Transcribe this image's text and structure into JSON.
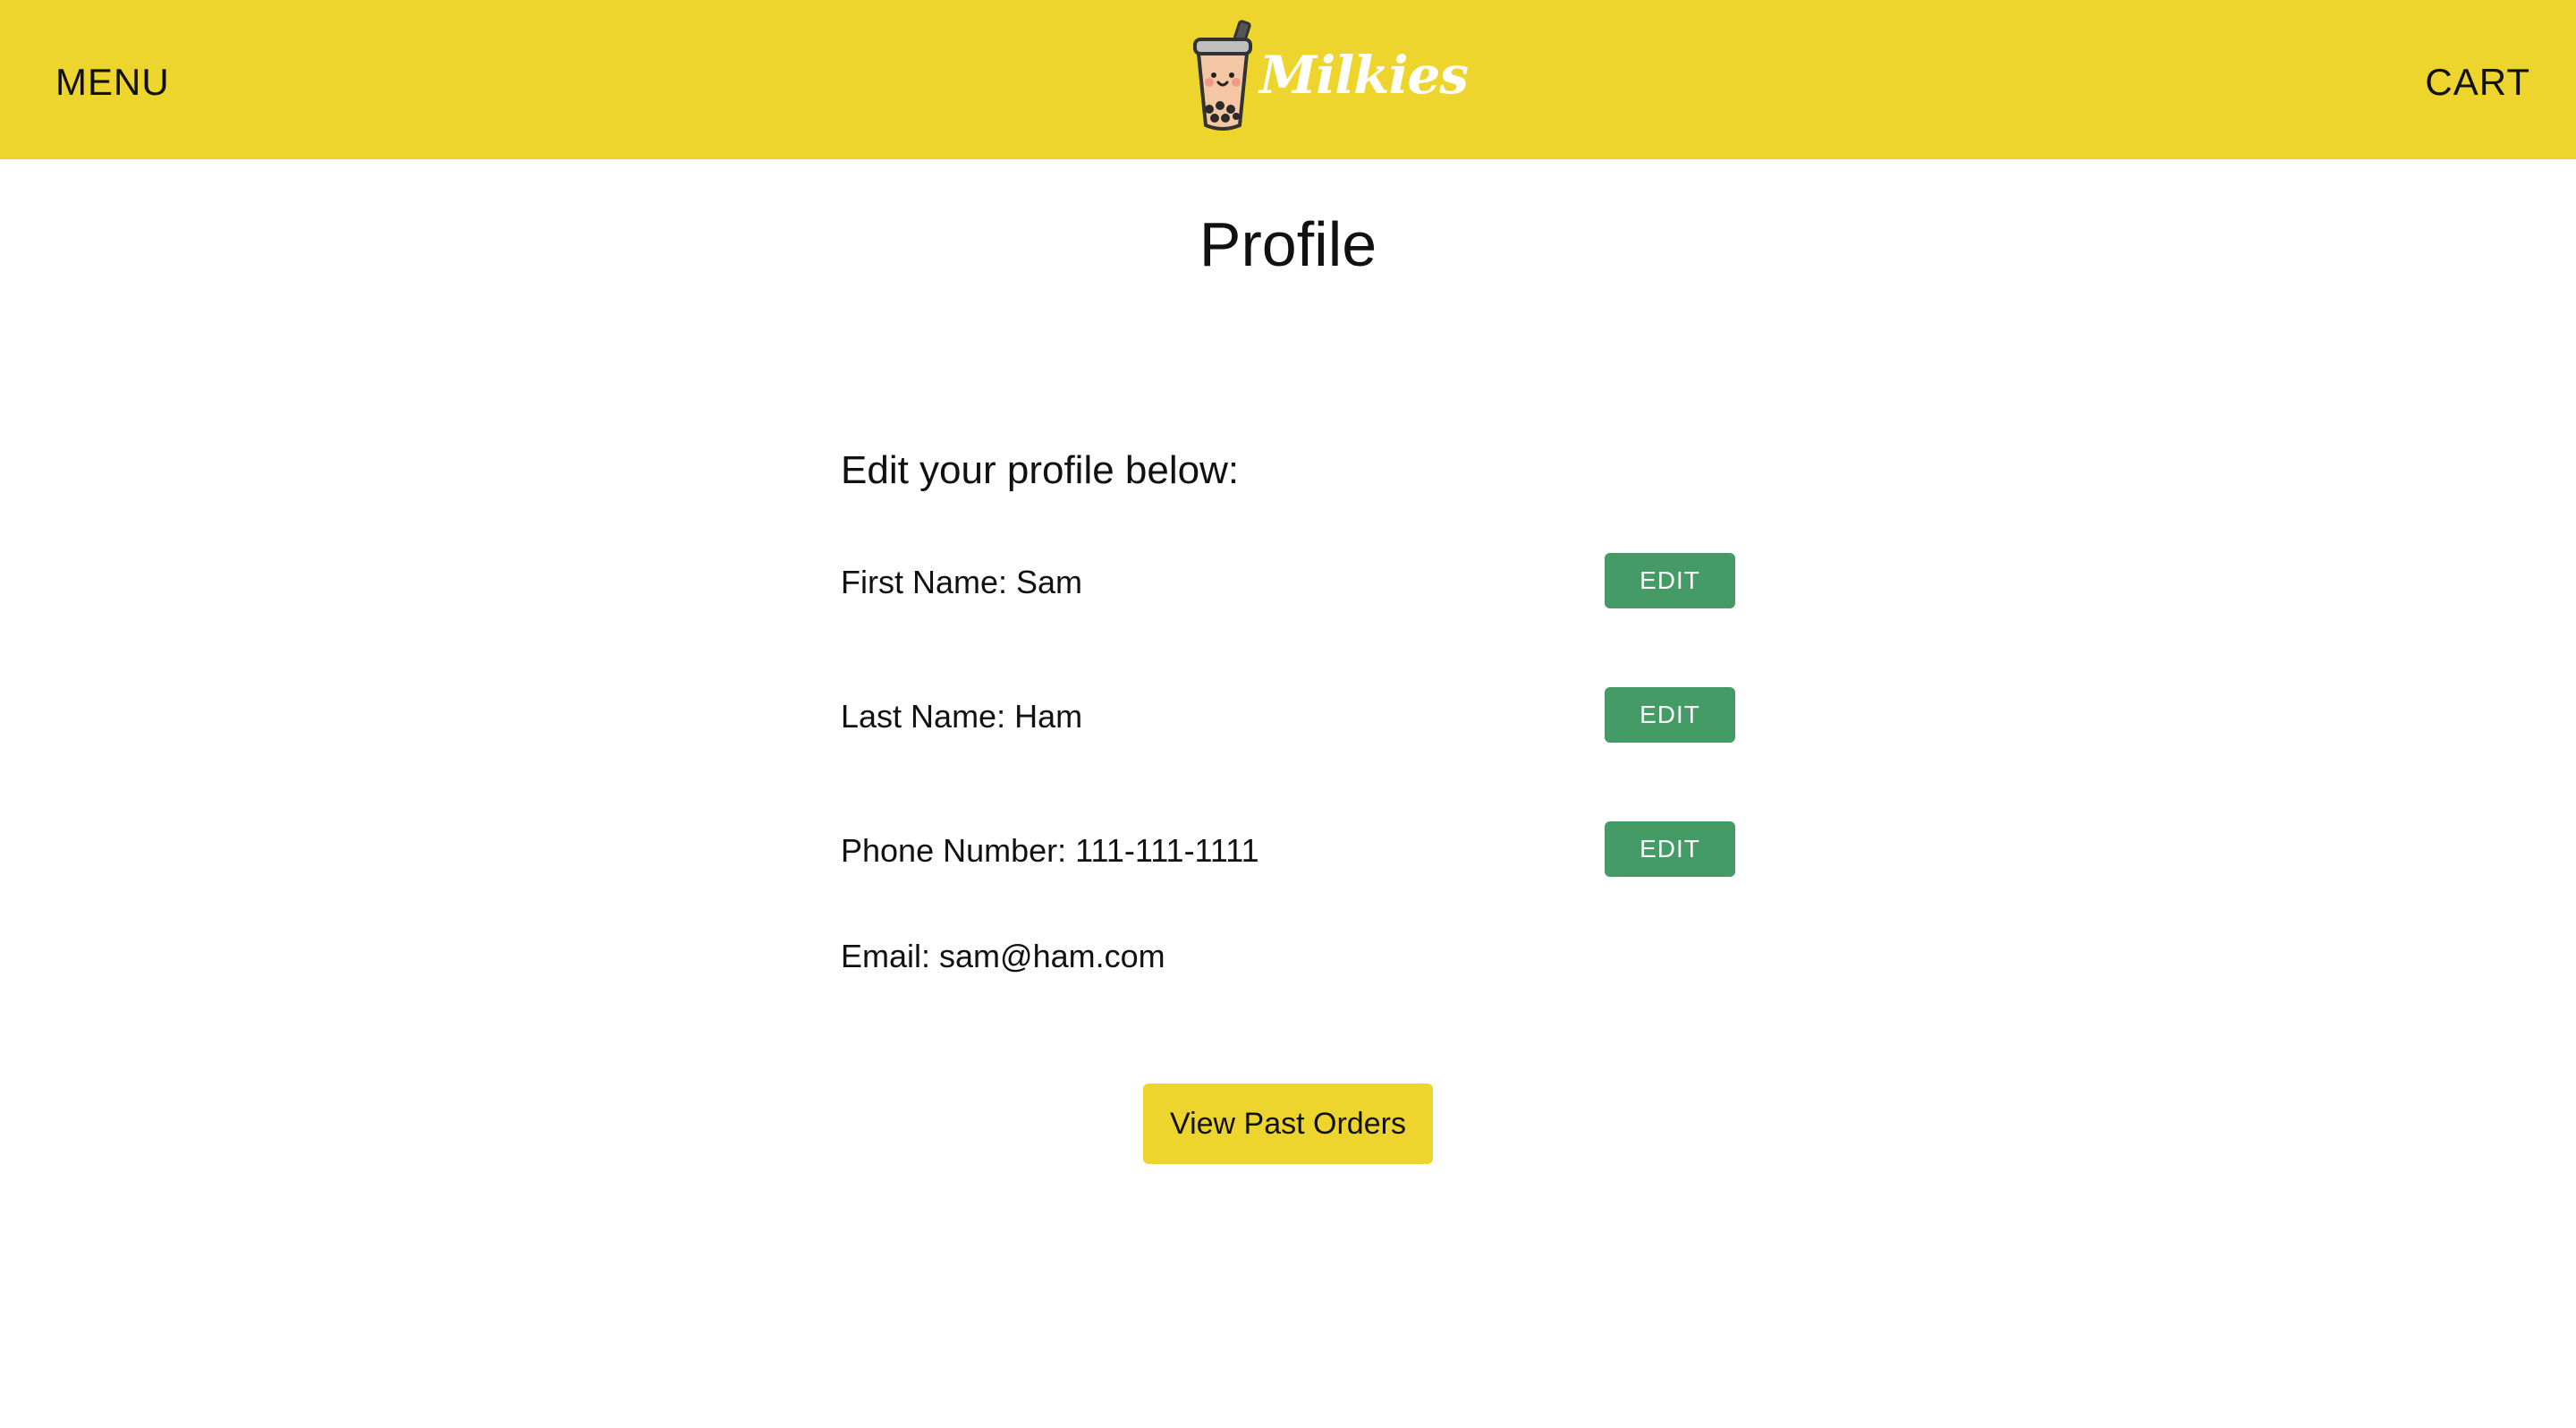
{
  "header": {
    "menu_label": "MENU",
    "cart_label": "CART",
    "logo_text": "Milkies",
    "logo_icon": "bubble-tea-cup-icon",
    "background_color": "#eed52d"
  },
  "page": {
    "title": "Profile",
    "intro": "Edit your profile below:"
  },
  "profile": {
    "first_name": "First Name: Sam",
    "last_name": "Last Name: Ham",
    "phone": "Phone Number: 111-111-1111",
    "email": "Email: sam@ham.com",
    "edit_label": "EDIT",
    "edit_color": "#449b66"
  },
  "actions": {
    "past_orders_label": "View Past Orders"
  }
}
